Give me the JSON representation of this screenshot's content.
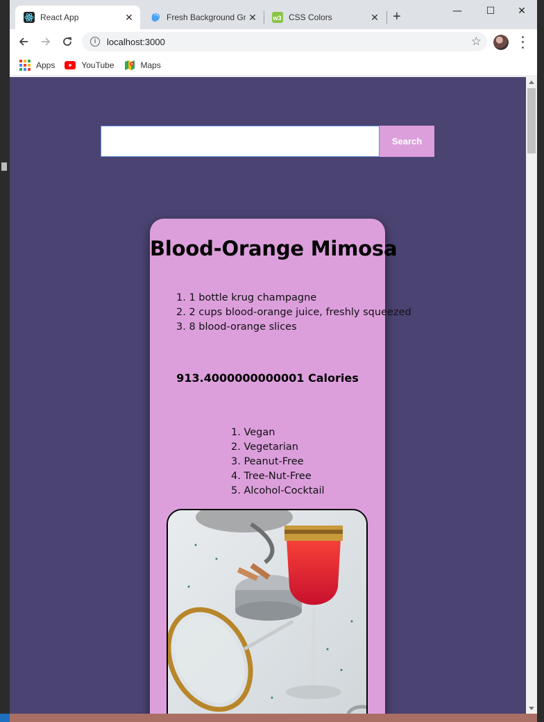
{
  "browser": {
    "tabs": [
      {
        "title": "React App",
        "active": true,
        "icon": "react-icon"
      },
      {
        "title": "Fresh Background Gra",
        "active": false,
        "icon": "blob-icon"
      },
      {
        "title": "CSS Colors",
        "active": false,
        "icon": "w3-icon"
      }
    ],
    "close_glyph": "✕",
    "new_tab_glyph": "+",
    "window": {
      "minimize": "—",
      "maximize": "☐",
      "close": "✕"
    },
    "url": "localhost:3000",
    "bookmarks": [
      {
        "label": "Apps",
        "icon": "apps-grid-icon"
      },
      {
        "label": "YouTube",
        "icon": "youtube-icon"
      },
      {
        "label": "Maps",
        "icon": "maps-icon"
      }
    ]
  },
  "page": {
    "background": "#4b4372",
    "accent": "#dc9fdc",
    "search": {
      "placeholder": "",
      "value": "",
      "button_label": "Search"
    },
    "recipe": {
      "title": "Blood-Orange Mimosa",
      "ingredients": [
        "1. 1 bottle krug champagne",
        "2. 2 cups blood-orange juice, freshly squeezed",
        "3. 8 blood-orange slices"
      ],
      "calories": "913.4000000000001 Calories",
      "health_labels": [
        "1. Vegan",
        "2. Vegetarian",
        "3. Peanut-Free",
        "4. Tree-Nut-Free",
        "5. Alcohol-Cocktail"
      ],
      "image_subject": "champagne-glass-with-blood-orange-drink"
    }
  }
}
